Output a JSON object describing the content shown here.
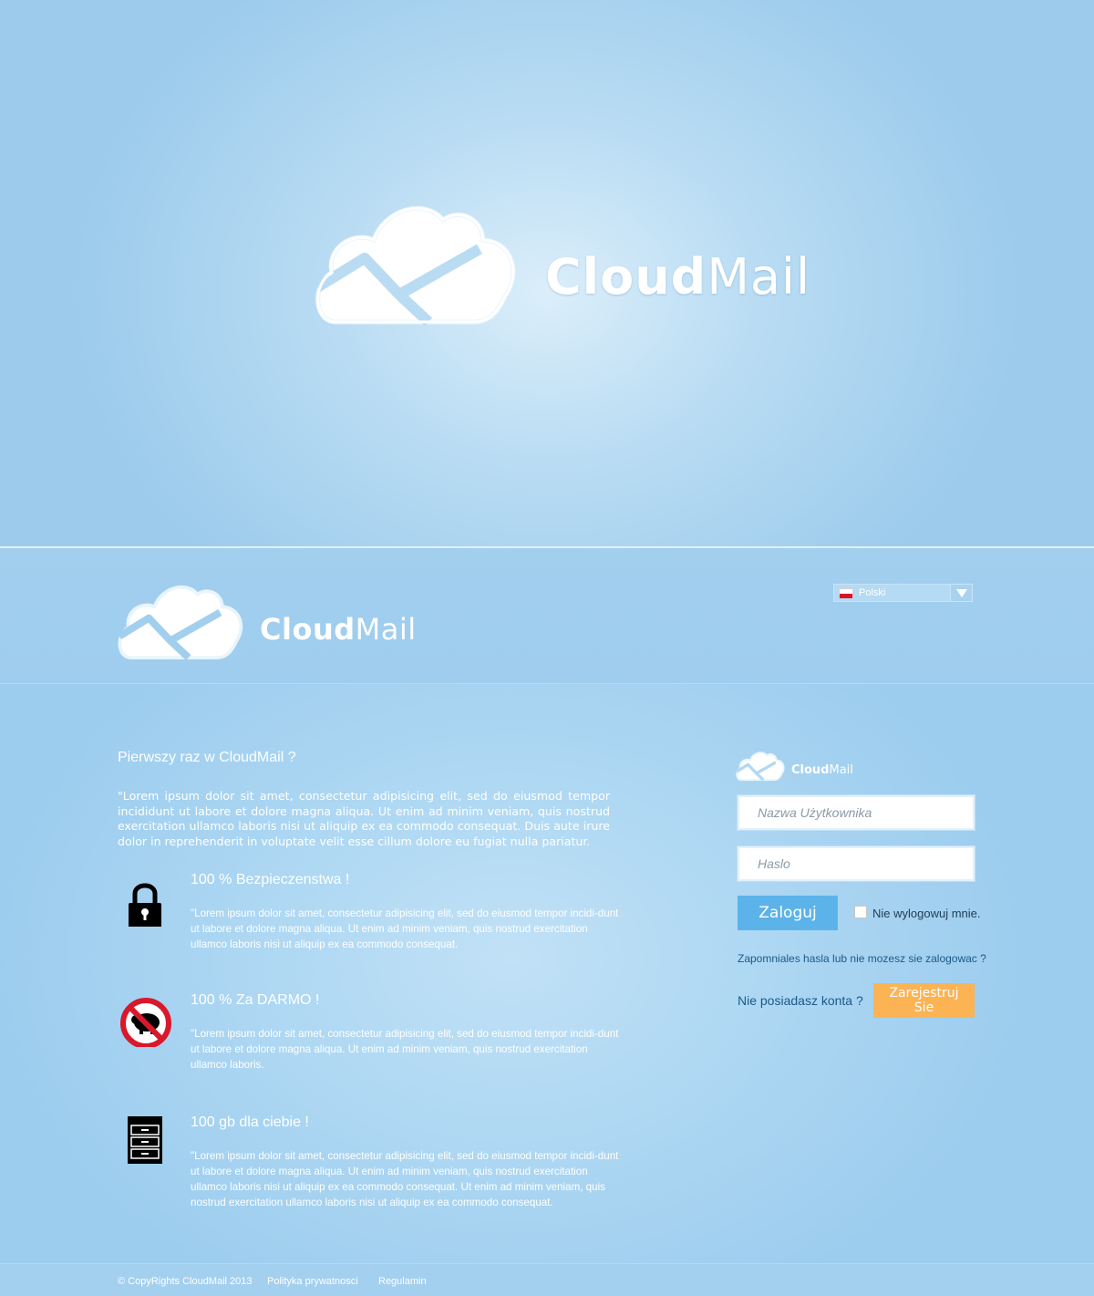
{
  "hero": {
    "title_bold": "Cloud",
    "title_light": "Mail"
  },
  "header": {
    "title_bold": "Cloud",
    "title_light": "Mail",
    "language": {
      "selected": "Polski",
      "flag": "poland-flag-icon"
    }
  },
  "intro": {
    "title": "Pierwszy raz w CloudMail ?",
    "text": "\"Lorem ipsum dolor sit amet, consectetur adipisicing elit, sed do eiusmod tempor incididunt ut labore et dolore magna aliqua. Ut enim ad minim veniam, quis nostrud exercitation ullamco laboris nisi ut aliquip ex ea commodo consequat. Duis aute irure dolor in reprehenderit in voluptate velit esse cillum dolore eu fugiat nulla pariatur."
  },
  "features": [
    {
      "icon": "padlock-icon",
      "title": "100 % Bezpieczenstwa !",
      "text": "\"Lorem ipsum dolor sit amet, consectetur adipisicing elit, sed do eiusmod tempor incidi-dunt ut labore et dolore magna aliqua. Ut enim ad minim veniam, quis nostrud exercitation ullamco laboris nisi ut aliquip ex ea commodo consequat."
    },
    {
      "icon": "no-piggy-bank-icon",
      "title": "100 % Za DARMO !",
      "text": "\"Lorem ipsum dolor sit amet, consectetur adipisicing elit, sed do eiusmod tempor incidi-dunt ut labore et dolore magna aliqua. Ut enim ad minim veniam, quis nostrud exercitation ullamco laboris."
    },
    {
      "icon": "file-cabinet-icon",
      "title": "100 gb dla ciebie !",
      "text": "\"Lorem ipsum dolor sit amet, consectetur adipisicing elit, sed do eiusmod tempor incidi-dunt ut labore et dolore magna aliqua. Ut enim ad minim veniam, quis nostrud exercitation ullamco laboris nisi ut aliquip ex ea commodo consequat. Ut enim ad minim veniam, quis nostrud exercitation ullamco laboris nisi ut aliquip ex ea commodo consequat."
    }
  ],
  "login": {
    "brand_bold": "Cloud",
    "brand_light": "Mail",
    "username_placeholder": "Nazwa Użytkownika",
    "password_placeholder": "Haslo",
    "login_button": "Zaloguj",
    "remember_label": "Nie wylogowuj mnie.",
    "forgot_link": "Zapomniales hasla lub nie mozesz sie zalogowac ?",
    "no_account": "Nie posiadasz konta ?",
    "register_button": "Zarejestruj Sie"
  },
  "footer": {
    "copyright": "© CopyRights CloudMail 2013",
    "privacy": "Polityka prywatnosci",
    "terms": "Regulamin"
  },
  "colors": {
    "background": "#9ccbec",
    "login_button": "#5cb3ea",
    "register_button": "#fbb354",
    "link": "#1a5a8a"
  }
}
